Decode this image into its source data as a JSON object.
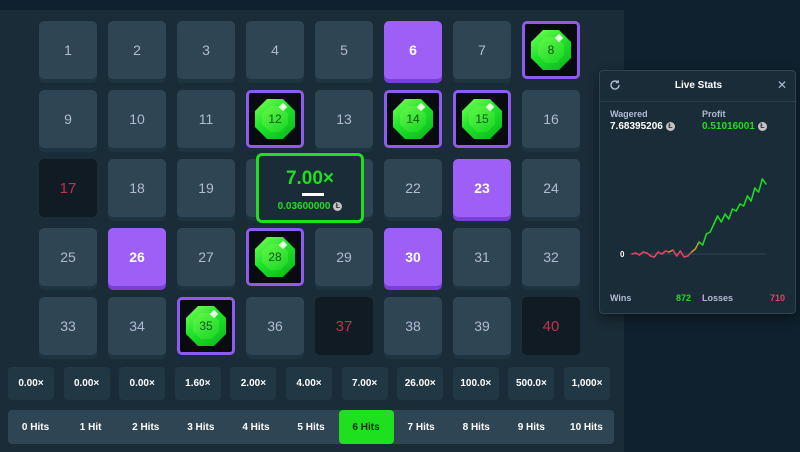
{
  "board": {
    "tiles": [
      {
        "n": "1",
        "state": "normal"
      },
      {
        "n": "2",
        "state": "normal"
      },
      {
        "n": "3",
        "state": "normal"
      },
      {
        "n": "4",
        "state": "normal"
      },
      {
        "n": "5",
        "state": "normal"
      },
      {
        "n": "6",
        "state": "selected"
      },
      {
        "n": "7",
        "state": "normal"
      },
      {
        "n": "8",
        "state": "hit"
      },
      {
        "n": "9",
        "state": "normal"
      },
      {
        "n": "10",
        "state": "normal"
      },
      {
        "n": "11",
        "state": "normal"
      },
      {
        "n": "12",
        "state": "hit"
      },
      {
        "n": "13",
        "state": "normal"
      },
      {
        "n": "14",
        "state": "hit"
      },
      {
        "n": "15",
        "state": "hit"
      },
      {
        "n": "16",
        "state": "normal"
      },
      {
        "n": "17",
        "state": "miss"
      },
      {
        "n": "18",
        "state": "normal"
      },
      {
        "n": "19",
        "state": "normal"
      },
      {
        "n": "20",
        "state": "normal"
      },
      {
        "n": "21",
        "state": "normal"
      },
      {
        "n": "22",
        "state": "normal"
      },
      {
        "n": "23",
        "state": "selected"
      },
      {
        "n": "24",
        "state": "normal"
      },
      {
        "n": "25",
        "state": "normal"
      },
      {
        "n": "26",
        "state": "selected"
      },
      {
        "n": "27",
        "state": "normal"
      },
      {
        "n": "28",
        "state": "hit"
      },
      {
        "n": "29",
        "state": "normal"
      },
      {
        "n": "30",
        "state": "selected"
      },
      {
        "n": "31",
        "state": "normal"
      },
      {
        "n": "32",
        "state": "normal"
      },
      {
        "n": "33",
        "state": "normal"
      },
      {
        "n": "34",
        "state": "normal"
      },
      {
        "n": "35",
        "state": "hit"
      },
      {
        "n": "36",
        "state": "normal"
      },
      {
        "n": "37",
        "state": "miss"
      },
      {
        "n": "38",
        "state": "normal"
      },
      {
        "n": "39",
        "state": "normal"
      },
      {
        "n": "40",
        "state": "miss"
      }
    ]
  },
  "win_popup": {
    "multiplier": "7.00×",
    "amount": "0.03600000",
    "coin_icon": "coin-icon"
  },
  "payouts": [
    "0.00×",
    "0.00×",
    "0.00×",
    "1.60×",
    "2.00×",
    "4.00×",
    "7.00×",
    "26.00×",
    "100.0×",
    "500.0×",
    "1,000×"
  ],
  "hits": {
    "labels": [
      "0 Hits",
      "1 Hit",
      "2 Hits",
      "3 Hits",
      "4 Hits",
      "5 Hits",
      "6 Hits",
      "7 Hits",
      "8 Hits",
      "9 Hits",
      "10 Hits"
    ],
    "active_index": 6
  },
  "live_stats": {
    "title": "Live Stats",
    "wagered_label": "Wagered",
    "wagered_value": "7.68395206",
    "profit_label": "Profit",
    "profit_value": "0.51016001",
    "zero_label": "0",
    "wins_label": "Wins",
    "wins_value": "872",
    "losses_label": "Losses",
    "losses_value": "710"
  },
  "colors": {
    "background": "#0f212e",
    "tile": "#2f4553",
    "selected": "#9d5ff5",
    "gem_green": "#1fe01f",
    "loss_red": "#ed4163"
  },
  "chart_data": {
    "type": "line",
    "title": "",
    "xlabel": "",
    "ylabel": "",
    "y": [
      0,
      0.01,
      -0.01,
      0.02,
      0.01,
      -0.02,
      -0.03,
      0.02,
      0.0,
      0.03,
      0.02,
      0.04,
      -0.02,
      0.03,
      -0.03,
      -0.02,
      0.02,
      0.05,
      0.12,
      0.09,
      0.2,
      0.22,
      0.3,
      0.38,
      0.32,
      0.4,
      0.35,
      0.45,
      0.43,
      0.5,
      0.48,
      0.58,
      0.53,
      0.66,
      0.62,
      0.75,
      0.7
    ],
    "zero_line": true,
    "positive_color": "#1fe01f",
    "negative_color": "#ed4163"
  }
}
